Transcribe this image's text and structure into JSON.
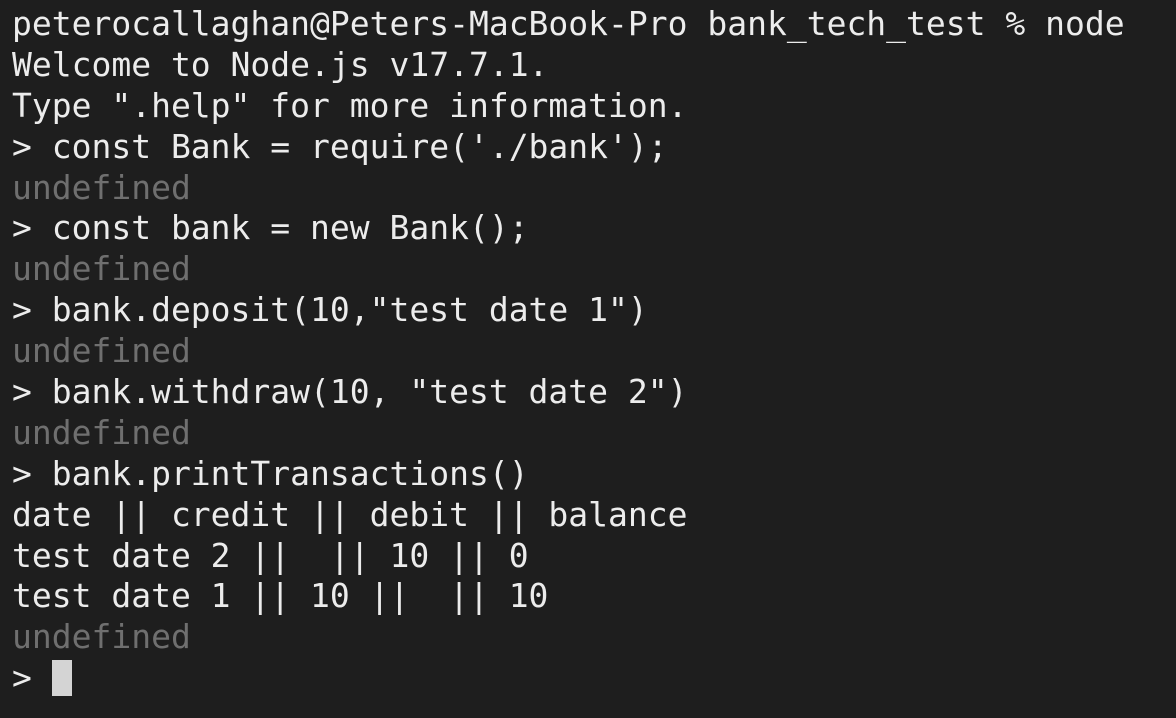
{
  "terminal": {
    "lines": [
      {
        "text": "peterocallaghan@Peters-MacBook-Pro bank_tech_test % node",
        "kind": "shell-prompt"
      },
      {
        "text": "Welcome to Node.js v17.7.1.",
        "kind": "output"
      },
      {
        "text": "Type \".help\" for more information.",
        "kind": "output"
      },
      {
        "text": "> const Bank = require('./bank');",
        "kind": "input"
      },
      {
        "text": "undefined",
        "kind": "result"
      },
      {
        "text": "> const bank = new Bank();",
        "kind": "input"
      },
      {
        "text": "undefined",
        "kind": "result"
      },
      {
        "text": "> bank.deposit(10,\"test date 1\")",
        "kind": "input"
      },
      {
        "text": "undefined",
        "kind": "result"
      },
      {
        "text": "> bank.withdraw(10, \"test date 2\")",
        "kind": "input"
      },
      {
        "text": "undefined",
        "kind": "result"
      },
      {
        "text": "> bank.printTransactions()",
        "kind": "input"
      },
      {
        "text": "date || credit || debit || balance",
        "kind": "output"
      },
      {
        "text": "test date 2 ||  || 10 || 0",
        "kind": "output"
      },
      {
        "text": "test date 1 || 10 ||  || 10",
        "kind": "output"
      },
      {
        "text": "undefined",
        "kind": "result"
      }
    ],
    "current_prompt": "> ",
    "colors": {
      "background": "#1e1e1e",
      "text": "#ececec",
      "dim_text": "#6f6f6f",
      "cursor": "#d4d4d4"
    }
  }
}
